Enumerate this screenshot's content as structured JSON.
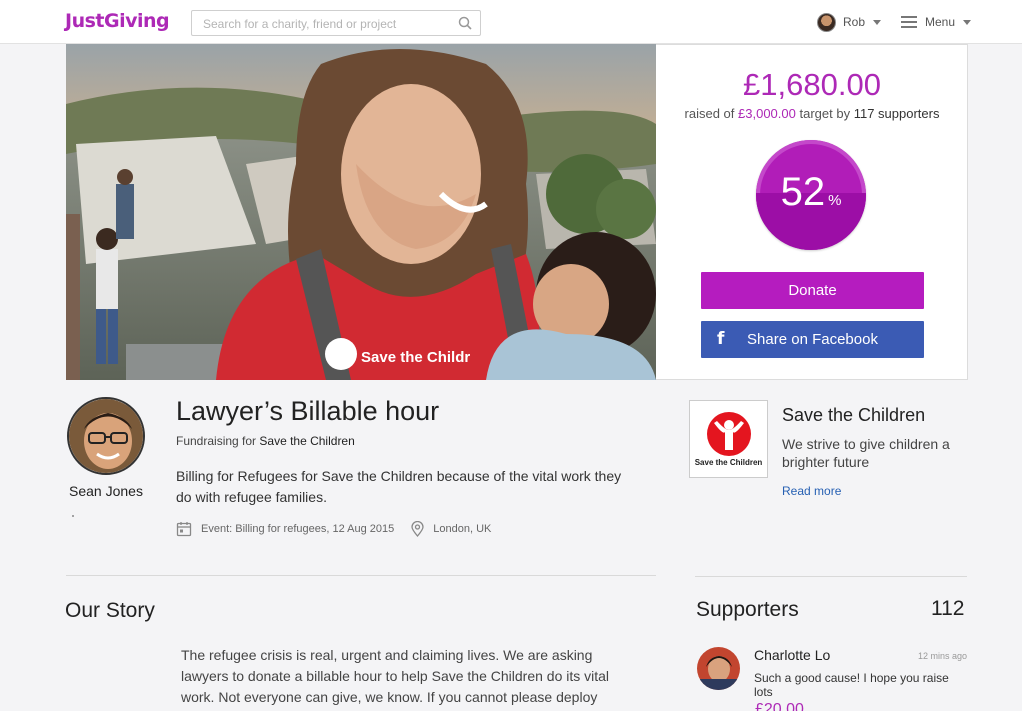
{
  "header": {
    "logo": "JustGiving",
    "search_placeholder": "Search for a charity, friend or project",
    "user_name": "Rob",
    "menu_label": "Menu"
  },
  "campaign": {
    "raised_amount": "£1,680.00",
    "raised_prefix": "raised of",
    "target_amount": "£3,000.00",
    "target_mid": "target by",
    "supporters_count_text": "117 supporters",
    "percent_value": 52,
    "percent_text": "52",
    "percent_sign": "%",
    "donate_label": "Donate",
    "facebook_label": "Share on Facebook",
    "facebook_glyph": "f"
  },
  "page": {
    "owner_name": "Sean Jones",
    "title": "Lawyer’s Billable hour",
    "fundraising_for_prefix": "Fundraising for",
    "fundraising_for_charity": "Save the Children",
    "description": "Billing for Refugees for Save the Children because of the vital work they do with refugee families.",
    "event_text": "Event: Billing for refugees, 12 Aug 2015",
    "location_text": "London, UK"
  },
  "charity": {
    "name": "Save the Children",
    "logo_caption": "Save the Children",
    "brand_color": "#e4151f",
    "tagline": "We strive to give children a brighter future",
    "read_more": "Read more"
  },
  "story": {
    "heading": "Our Story",
    "text": "The refugee crisis is real, urgent and claiming lives. We are asking lawyers to donate a billable hour to help Save the Children do its vital work. Not everyone can give, we know. If you cannot please deploy your advocacy"
  },
  "supporters": {
    "heading": "Supporters",
    "count": "112",
    "items": [
      {
        "name": "Charlotte Lo",
        "time": "12 mins ago",
        "message": "Such a good cause! I hope you raise lots",
        "amount": "£20.00"
      }
    ]
  },
  "colors": {
    "brand": "#ad29b6",
    "donate": "#b51cbf",
    "facebook": "#3b5bb4",
    "link": "#2660b3"
  }
}
